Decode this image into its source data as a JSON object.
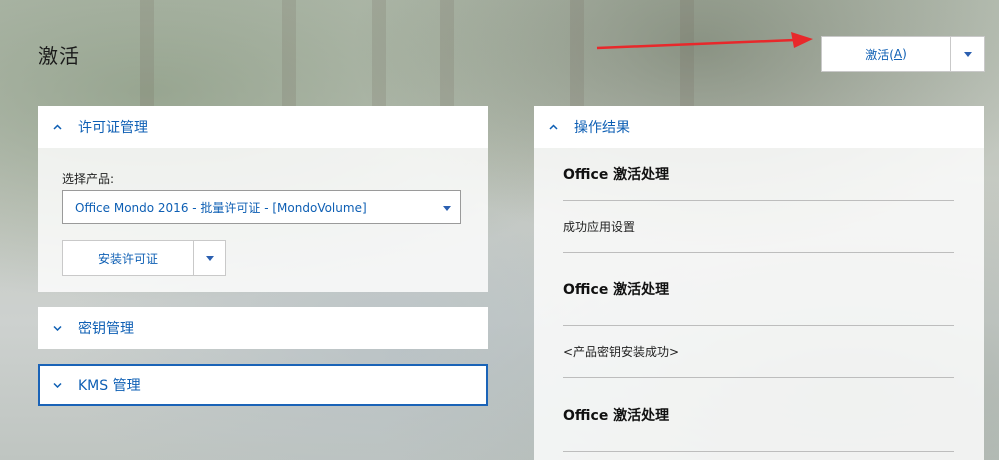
{
  "page": {
    "title": "激活"
  },
  "activate": {
    "label_prefix": "激活(",
    "label_key": "A",
    "label_suffix": ")"
  },
  "license_panel": {
    "title": "许可证管理",
    "select_label": "选择产品:",
    "selected_product": "Office Mondo 2016 - 批量许可证 - [MondoVolume]",
    "install_label": "安装许可证"
  },
  "key_panel": {
    "title": "密钥管理"
  },
  "kms_panel": {
    "title": "KMS 管理"
  },
  "results_panel": {
    "title": "操作结果",
    "items": [
      {
        "text": "Office 激活处理",
        "type": "heading"
      },
      {
        "text": "成功应用设置",
        "type": "text"
      },
      {
        "text": "Office 激活处理",
        "type": "heading"
      },
      {
        "text": "<产品密钥安装成功>",
        "type": "text"
      },
      {
        "text": "Office 激活处理",
        "type": "heading"
      }
    ]
  },
  "colors": {
    "accent": "#0e5fb4",
    "arrow": "#e8282b",
    "kms_border": "#1a63b7"
  }
}
